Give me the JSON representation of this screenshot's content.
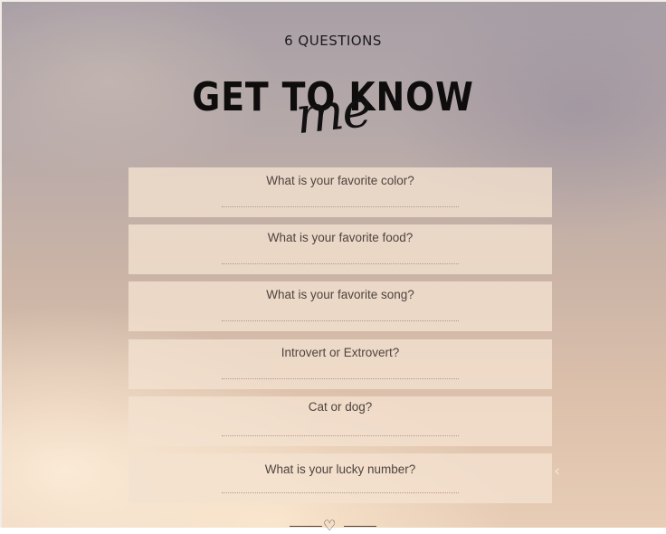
{
  "header": {
    "subtitle": "6 QUESTIONS",
    "title": "GET TO KNOW",
    "script_word": "me"
  },
  "questions": [
    {
      "text": "What is your favorite color?"
    },
    {
      "text": "What is your favorite food?"
    },
    {
      "text": "What is your favorite song?"
    },
    {
      "text": "Introvert or Extrovert?"
    },
    {
      "text": "Cat or dog?"
    },
    {
      "text": "What is your lucky number?"
    }
  ],
  "icons": {
    "chevron": "chevron-left-icon",
    "ornament": "heart-icon"
  },
  "colors": {
    "card_background": "#f3e2d0",
    "question_text": "#4e4440",
    "title_text": "#0e0c0c"
  }
}
